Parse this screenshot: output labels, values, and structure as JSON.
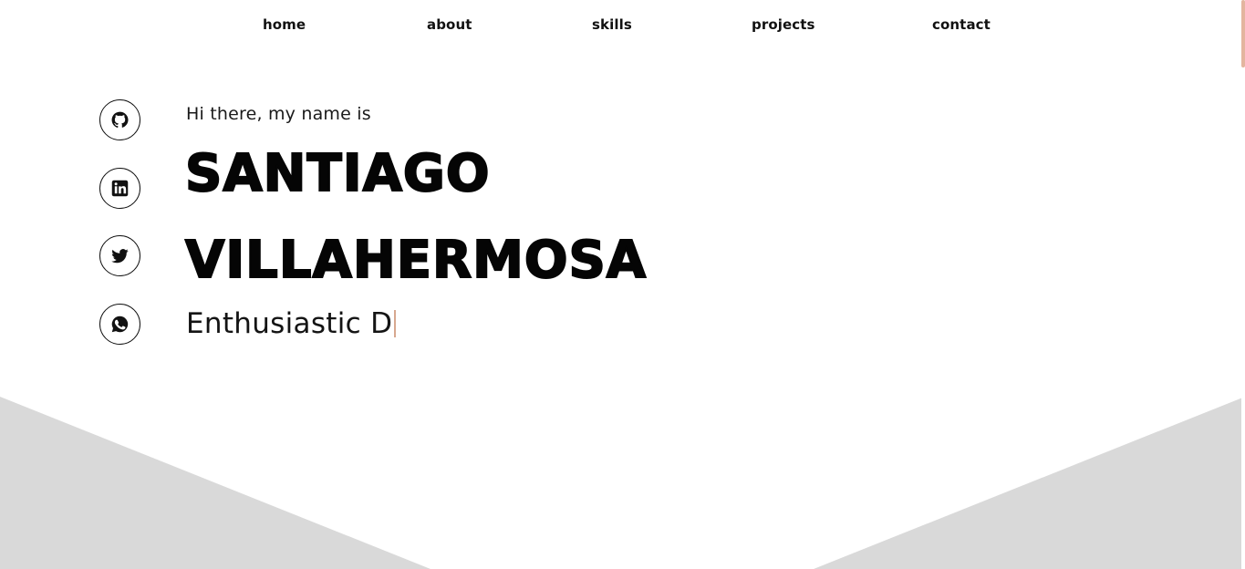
{
  "nav": {
    "items": [
      "home",
      "about",
      "skills",
      "projects",
      "contact"
    ]
  },
  "social": [
    {
      "name": "github",
      "icon": "github-icon"
    },
    {
      "name": "linkedin",
      "icon": "linkedin-icon"
    },
    {
      "name": "twitter",
      "icon": "twitter-icon"
    },
    {
      "name": "whatsapp",
      "icon": "whatsapp-icon"
    }
  ],
  "hero": {
    "greeting": "Hi there, my name is",
    "first_name": "SANTIAGO",
    "last_name": "VILLAHERMOSA",
    "typed_text": "Enthusiastic D"
  },
  "colors": {
    "accent": "#d7a88f",
    "background_shape": "#d9d9d9",
    "text": "#0a0a0a"
  }
}
